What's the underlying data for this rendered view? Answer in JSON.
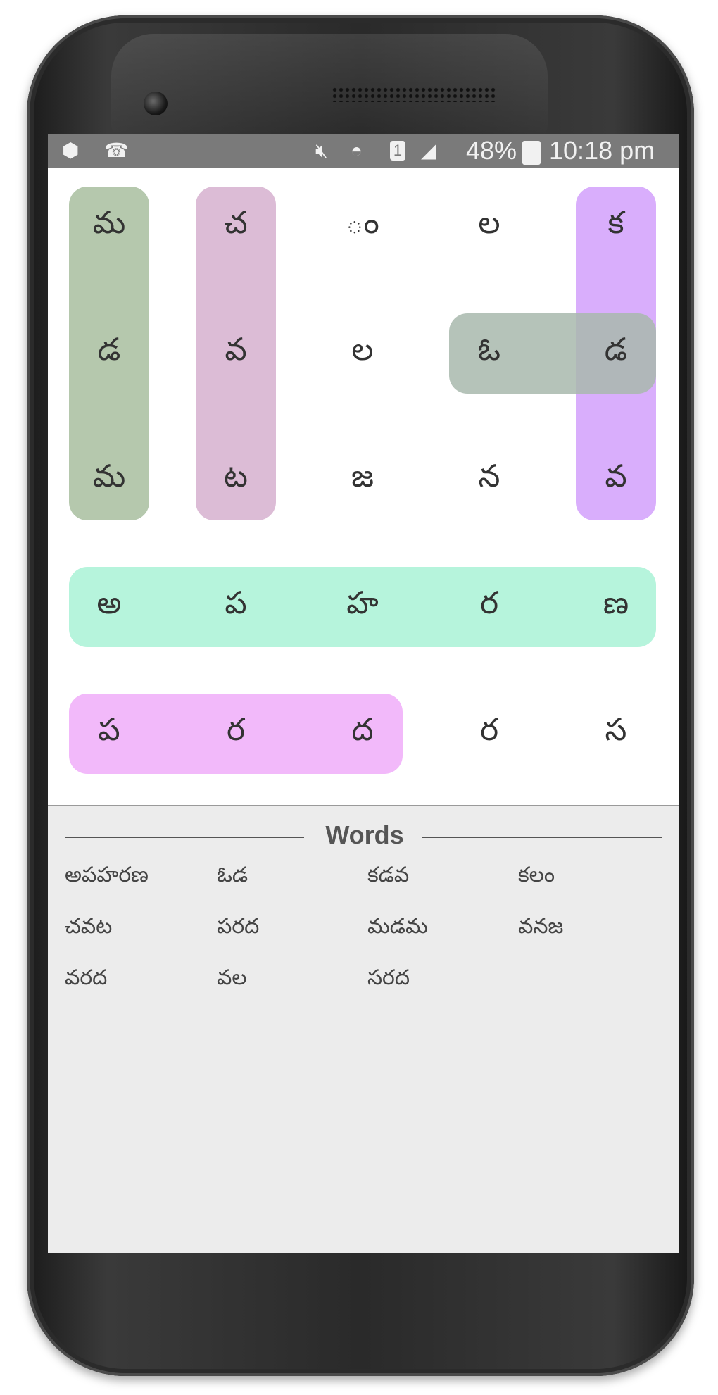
{
  "status_bar": {
    "battery_percent": "48%",
    "time": "10:18 pm",
    "sim_label": "1",
    "icons": [
      "app-notification-icon",
      "missed-call-icon",
      "mute-icon",
      "wifi-icon",
      "sim-icon",
      "signal-icon",
      "battery-charging-icon"
    ]
  },
  "grid": {
    "rows": [
      [
        "మ",
        "చ",
        "ం",
        "ల",
        "క"
      ],
      [
        "డ",
        "వ",
        "ల",
        "ఓ",
        "డ"
      ],
      [
        "మ",
        "ట",
        "జ",
        "న",
        "వ"
      ],
      [
        "అ",
        "ప",
        "హ",
        "ర",
        "ణ"
      ],
      [
        "ప",
        "ర",
        "ద",
        "ర",
        "స"
      ]
    ],
    "highlight_colors": {
      "col1": "#b5c8ad",
      "col2": "#dcbcd6",
      "col5": "#d9aefc",
      "row2_pair": "#a8b8ad",
      "row4": "#b6f4dc",
      "row5": "#f2b9fa"
    }
  },
  "words_panel": {
    "title": "Words",
    "words": [
      "అపహరణ",
      "ఓడ",
      "కడవ",
      "కలం",
      "చవట",
      "పరద",
      "మడమ",
      "వనజ",
      "వరద",
      "వల",
      "సరద"
    ]
  }
}
